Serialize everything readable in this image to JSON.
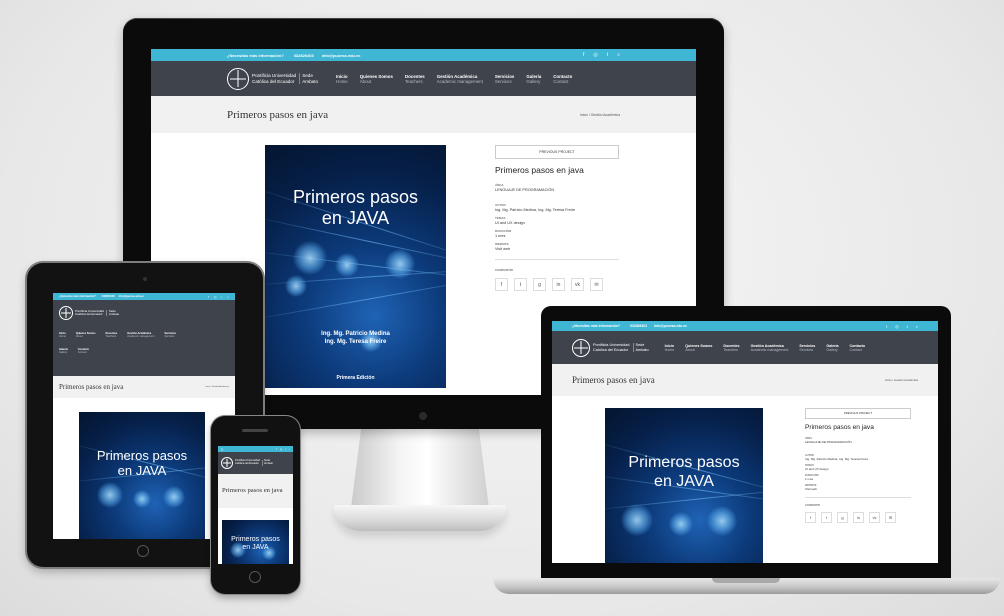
{
  "site": {
    "topbar_text": "¿Necesitas más información?",
    "topbar_phone": "032826403",
    "topbar_email": "info@pucesa.edu.ec",
    "topbar_icons": [
      "facebook-icon",
      "instagram-icon",
      "twitter-icon",
      "search-icon"
    ],
    "logo_line1": "Pontificia Universidad",
    "logo_line2": "Católica del Ecuador",
    "logo_sede1": "Sede",
    "logo_sede2": "Ambato",
    "nav": [
      {
        "title": "Inicio",
        "sub": "Home"
      },
      {
        "title": "Quienes Somos",
        "sub": "About"
      },
      {
        "title": "Docentes",
        "sub": "Teachers"
      },
      {
        "title": "Gestión Académica",
        "sub": "Academic management"
      },
      {
        "title": "Servicios",
        "sub": "Services"
      },
      {
        "title": "Galería",
        "sub": "Gallery"
      },
      {
        "title": "Contacto",
        "sub": "Contact"
      }
    ],
    "page_title": "Primeros pasos en java",
    "breadcrumb": "Inicio / Gestión Académica",
    "cover": {
      "title_line1": "Primeros pasos",
      "title_line2": "en JAVA",
      "author1": "Ing. Mg. Patricio Medina",
      "author2": "Ing. Mg. Teresa Freire",
      "edition": "Primera Edición"
    },
    "info": {
      "prev_button": "PREVIOUS PROJECT",
      "title": "Primeros pasos en java",
      "label_area": "ÁREA",
      "value_area": "LENGUAJE DE PROGRAMACIÓN",
      "label_autor": "AUTOR",
      "value_autor": "Ing. Mg. Patricio Medina, Ing. Mg. Teresa Freire",
      "label_tema": "TEMAS",
      "value_tema": "UI and UX design",
      "label_duracion": "DURACIÓN",
      "value_duracion": "1 mes",
      "label_website": "WEBSITE",
      "value_website": "Visit web",
      "label_share": "COMPARTIR",
      "share_icons": [
        "facebook-icon",
        "twitter-icon",
        "googleplus-icon",
        "linkedin-icon",
        "vk-icon",
        "email-icon"
      ]
    }
  }
}
